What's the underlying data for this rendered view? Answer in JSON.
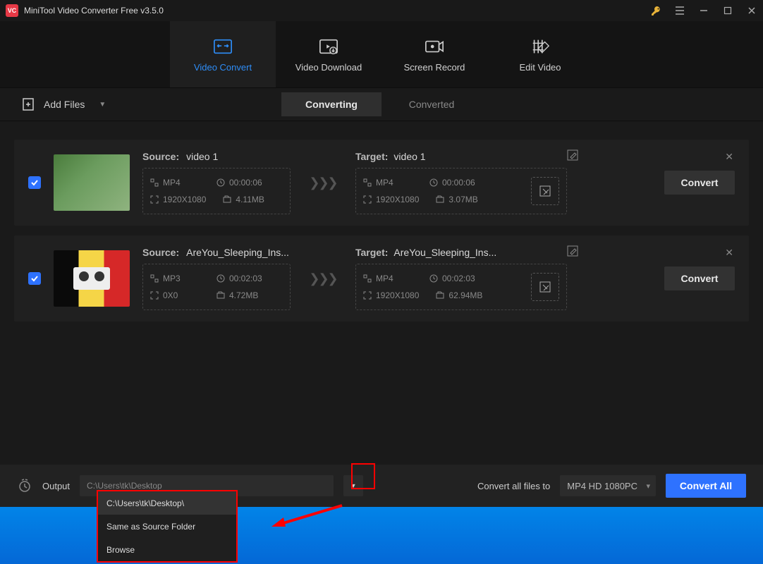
{
  "title": "MiniTool Video Converter Free v3.5.0",
  "tabs": [
    {
      "label": "Video Convert"
    },
    {
      "label": "Video Download"
    },
    {
      "label": "Screen Record"
    },
    {
      "label": "Edit Video"
    }
  ],
  "toolbar": {
    "add_files": "Add Files",
    "segments": [
      "Converting",
      "Converted"
    ]
  },
  "items": [
    {
      "source_label": "Source:",
      "source_name": "video 1",
      "src_format": "MP4",
      "src_duration": "00:00:06",
      "src_res": "1920X1080",
      "src_size": "4.11MB",
      "target_label": "Target:",
      "target_name": "video 1",
      "tgt_format": "MP4",
      "tgt_duration": "00:00:06",
      "tgt_res": "1920X1080",
      "tgt_size": "3.07MB",
      "convert": "Convert"
    },
    {
      "source_label": "Source:",
      "source_name": "AreYou_Sleeping_Ins...",
      "src_format": "MP3",
      "src_duration": "00:02:03",
      "src_res": "0X0",
      "src_size": "4.72MB",
      "target_label": "Target:",
      "target_name": "AreYou_Sleeping_Ins...",
      "tgt_format": "MP4",
      "tgt_duration": "00:02:03",
      "tgt_res": "1920X1080",
      "tgt_size": "62.94MB",
      "convert": "Convert"
    }
  ],
  "arrows": "❯❯❯",
  "bottom": {
    "output_label": "Output",
    "output_path": "C:\\Users\\tk\\Desktop",
    "all_label": "Convert all files to",
    "preset": "MP4 HD 1080PC",
    "convert_all": "Convert All"
  },
  "dropdown": {
    "opt0": "C:\\Users\\tk\\Desktop\\",
    "opt1": "Same as Source Folder",
    "opt2": "Browse"
  }
}
